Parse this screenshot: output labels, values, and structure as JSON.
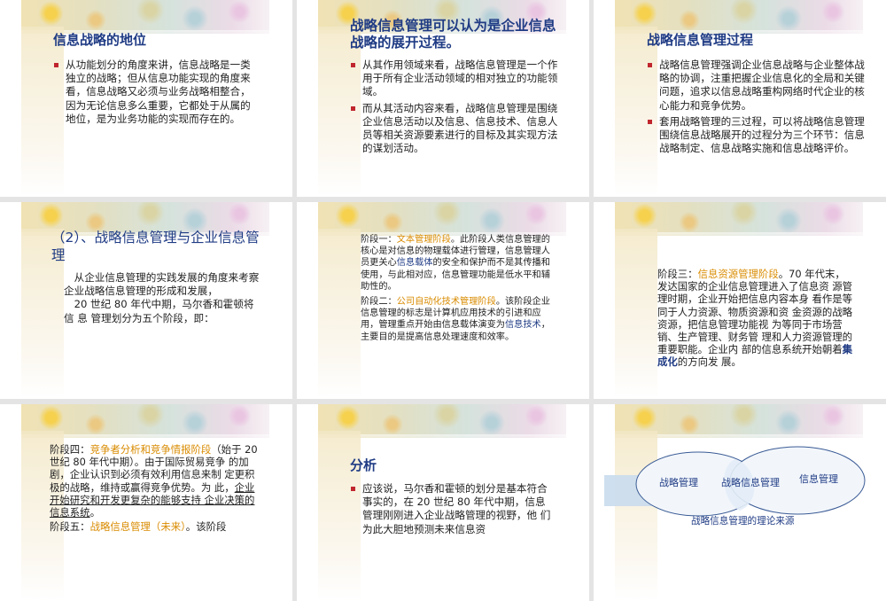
{
  "slides": [
    {
      "title": "信息战略的地位",
      "bullets": [
        "从功能划分的角度来讲，信息战略是一类独立的战略；但从信息功能实现的角度来看，信息战略又必须与业务战略相整合，因为无论信息多么重要，它都处于从属的地位，是为业务功能的实现而存在的。"
      ]
    },
    {
      "title": "战略信息管理可以认为是企业信息战略的展开过程。",
      "bullets": [
        "从其作用领域来看，战略信息管理是一个作用于所有企业活动领域的相对独立的功能领域。",
        "而从其活动内容来看，战略信息管理是围绕企业信息活动以及信息、信息技术、信息人员等相关资源要素进行的目标及其实现方法的谋划活动。"
      ]
    },
    {
      "title": "战略信息管理过程",
      "bullets": [
        "战略信息管理强调企业信息战略与企业整体战略的协调，注重把握企业信息化的全局和关键问题，追求以信息战略重构网络时代企业的核心能力和竞争优势。",
        "套用战略管理的三过程，可以将战略信息管理围绕信息战略展开的过程分为三个环节：信息战略制定、信息战略实施和信息战略评价。"
      ]
    },
    {
      "title": "（2）、战略信息管理与企业信息管理",
      "para1": "从企业信息管理的实践发展的角度来考察企业战略信息管理的形成和发展，",
      "para2": "20 世纪 80 年代中期，马尔香和霍顿将信 息 管理划分为五个阶段，即："
    },
    {
      "p1_lead": "阶段一：",
      "p1_term": "文本管理阶段",
      "p1_a": "。此阶段人类信息管理的核心是对信息的物理载体进行管理，信息管理人员更关心",
      "p1_term2": "信息载体",
      "p1_b": "的安全和保护而不是其传播和使用，与此相对应，信息管理功能是低水平和辅助性的。",
      "p2_lead": "阶段二：",
      "p2_term": "公司自动化技术管理阶段",
      "p2_a": "。该阶段企业信息管理的标志是计算机应用技术的引进和应用，管理重点开始由信息载体演变为",
      "p2_term2": "信息技术",
      "p2_b": "，主要目的是提高信息处理速度和效率。"
    },
    {
      "lead": "阶段三：",
      "term": "信息资源管理阶段",
      "a": "。70 年代末，发达国家的企业信息管理进入了信息资 源管理时期，企业开始把信息内容本身 看作是等同于人力资源、物质资源和资 金资源的战略资源，把信息管理功能视 为等同于市场营销、生产管理、财务管 理和人力资源管理的重要职能。企业内 部的信息系统开始朝着",
      "term2": "集成化",
      "b": "的方向发 展。"
    },
    {
      "lead": "阶段四：",
      "term": "竞争者分析和竞争情报阶段",
      "a": "（始于 20 世纪 80 年代中期）。由于国际贸易竞争 的加剧，企业认识到必须有效利用信息来制 定更积极的战略，维持或赢得竞争优势。为 此，",
      "underlined": "企业开始研究和开发更复杂的能够支持 企业决策的信息系统",
      "b": "。",
      "next_lead": "阶段五：",
      "next_term": "战略信息管理（未来）",
      "next_a": "。该阶段"
    },
    {
      "title": "分析",
      "bullets": [
        "应该说，马尔香和霍顿的划分是基本符合事实的，在 20 世纪 80 年代中期，信息 管理刚刚进入企业战略管理的视野，他 们为此大胆地预测未来信息资"
      ]
    },
    {
      "left_label": "战略管理",
      "center_label": "战略信息管理",
      "right_label": "信息管理",
      "caption": "战略信息管理的理论来源"
    }
  ]
}
